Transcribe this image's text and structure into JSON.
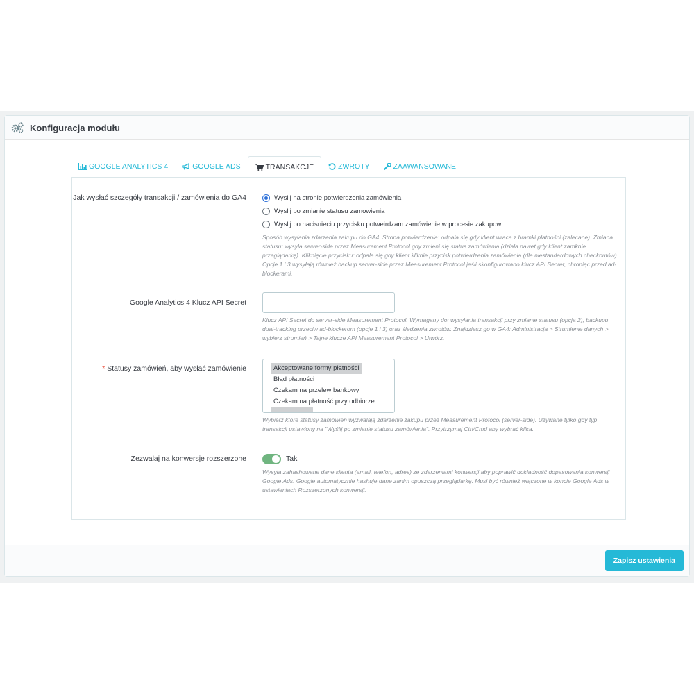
{
  "panel": {
    "title": "Konfiguracja modułu",
    "icon": "cogs-icon"
  },
  "tabs": [
    {
      "label": "GOOGLE ANALYTICS 4",
      "icon": "bar-chart-icon",
      "active": false
    },
    {
      "label": "GOOGLE ADS",
      "icon": "bullhorn-icon",
      "active": false
    },
    {
      "label": "TRANSAKCJE",
      "icon": "cart-icon",
      "active": true
    },
    {
      "label": "ZWROTY",
      "icon": "undo-icon",
      "active": false
    },
    {
      "label": "ZAAWANSOWANE",
      "icon": "wrench-icon",
      "active": false
    }
  ],
  "form": {
    "send_method": {
      "label": "Jak wysłać szczegóły transakcji / zamówienia do GA4",
      "options": [
        "Wyslij na stronie potwierdzenia zamówienia",
        "Wyslij po zmianie statusu zamowienia",
        "Wyslij po nacisnieciu przycisku potweirdzam zamówienie w procesie zakupow"
      ],
      "selected_index": 0,
      "help": "Sposób wysyłania zdarzenia zakupu do GA4. Strona potwierdzenia: odpala się gdy klient wraca z bramki płatności (zalecane). Zmiana statusu: wysyła server-side przez Measurement Protocol gdy zmieni się status zamówienia (działa nawet gdy klient zamknie przeglądarkę). Kliknięcie przycisku: odpala się gdy klient kliknie przycisk potwierdzenia zamówienia (dla niestandardowych checkoutów). Opcje 1 i 3 wysyłają również backup server-side przez Measurement Protocol jeśli skonfigurowano klucz API Secret, chroniąc przed ad-blockerami."
    },
    "api_secret": {
      "label": "Google Analytics 4 Klucz API Secret",
      "value": "",
      "help": "Klucz API Secret do server-side Measurement Protocol. Wymagany do: wysyłania transakcji przy zmianie statusu (opcja 2), backupu dual-tracking przeciw ad-blockerom (opcje 1 i 3) oraz śledzenia zwrotów. Znajdziesz go w GA4: Administracja > Strumienie danych > wybierz strumień > Tajne klucze API Measurement Protocol > Utwórz."
    },
    "statuses": {
      "required_mark": "*",
      "label": "Statusy zamówień, aby wysłać zamówienie",
      "options": [
        {
          "label": "Akceptowane formy płatności",
          "selected": true
        },
        {
          "label": "Błąd płatności",
          "selected": false
        },
        {
          "label": "Czekam na przelew bankowy",
          "selected": false
        },
        {
          "label": "Czekam na płatność przy odbiorze",
          "selected": false
        }
      ],
      "help": "Wybierz które statusy zamówień wyzwalają zdarzenie zakupu przez Measurement Protocol (server-side). Używane tylko gdy typ transakcji ustawiony na \"Wyślij po zmianie statusu zamówienia\". Przytrzymaj Ctrl/Cmd aby wybrać kilka."
    },
    "enhanced_conversions": {
      "label": "Zezwalaj na konwersje rozszerzone",
      "value_label": "Tak",
      "enabled": true,
      "help": "Wysyła zahashowane dane klienta (email, telefon, adres) ze zdarzeniami konwersji aby poprawić dokładność dopasowania konwersji Google Ads. Google automatycznie hashuje dane zanim opuszczą przeglądarkę. Musi być również włączone w koncie Google Ads w ustawieniach Rozszerzonych konwersji."
    }
  },
  "footer": {
    "save_label": "Zapisz ustawienia"
  },
  "colors": {
    "accent": "#25b9d7",
    "switch_on": "#70b580",
    "required": "#e84f3c"
  }
}
